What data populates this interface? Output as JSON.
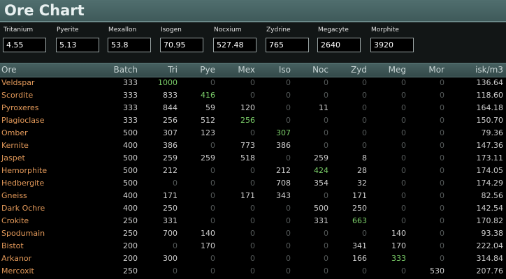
{
  "window": {
    "title": "Ore Chart"
  },
  "minerals": [
    {
      "label": "Tritanium",
      "value": "4.55"
    },
    {
      "label": "Pyerite",
      "value": "5.13"
    },
    {
      "label": "Mexallon",
      "value": "53.8"
    },
    {
      "label": "Isogen",
      "value": "70.95"
    },
    {
      "label": "Nocxium",
      "value": "527.48"
    },
    {
      "label": "Zydrine",
      "value": "765"
    },
    {
      "label": "Megacyte",
      "value": "2640"
    },
    {
      "label": "Morphite",
      "value": "3920"
    }
  ],
  "table": {
    "headers": [
      "Ore",
      "Batch",
      "Tri",
      "Pye",
      "Mex",
      "Iso",
      "Noc",
      "Zyd",
      "Meg",
      "Mor",
      "isk/m3"
    ],
    "rows": [
      {
        "ore": "Veldspar",
        "values": [
          "333",
          "1000",
          "0",
          "0",
          "0",
          "0",
          "0",
          "0",
          "0",
          "136.64"
        ],
        "highlight": 1
      },
      {
        "ore": "Scordite",
        "values": [
          "333",
          "833",
          "416",
          "0",
          "0",
          "0",
          "0",
          "0",
          "0",
          "118.60"
        ],
        "highlight": 2
      },
      {
        "ore": "Pyroxeres",
        "values": [
          "333",
          "844",
          "59",
          "120",
          "0",
          "11",
          "0",
          "0",
          "0",
          "164.18"
        ],
        "highlight": -1
      },
      {
        "ore": "Plagioclase",
        "values": [
          "333",
          "256",
          "512",
          "256",
          "0",
          "0",
          "0",
          "0",
          "0",
          "150.70"
        ],
        "highlight": 3
      },
      {
        "ore": "Omber",
        "values": [
          "500",
          "307",
          "123",
          "0",
          "307",
          "0",
          "0",
          "0",
          "0",
          "79.36"
        ],
        "highlight": 4
      },
      {
        "ore": "Kernite",
        "values": [
          "400",
          "386",
          "0",
          "773",
          "386",
          "0",
          "0",
          "0",
          "0",
          "147.36"
        ],
        "highlight": -1
      },
      {
        "ore": "Jaspet",
        "values": [
          "500",
          "259",
          "259",
          "518",
          "0",
          "259",
          "8",
          "0",
          "0",
          "173.11"
        ],
        "highlight": -1
      },
      {
        "ore": "Hemorphite",
        "values": [
          "500",
          "212",
          "0",
          "0",
          "212",
          "424",
          "28",
          "0",
          "0",
          "174.05"
        ],
        "highlight": 5
      },
      {
        "ore": "Hedbergite",
        "values": [
          "500",
          "0",
          "0",
          "0",
          "708",
          "354",
          "32",
          "0",
          "0",
          "174.29"
        ],
        "highlight": -1
      },
      {
        "ore": "Gneiss",
        "values": [
          "400",
          "171",
          "0",
          "171",
          "343",
          "0",
          "171",
          "0",
          "0",
          "82.56"
        ],
        "highlight": -1
      },
      {
        "ore": "Dark Ochre",
        "values": [
          "400",
          "250",
          "0",
          "0",
          "0",
          "500",
          "250",
          "0",
          "0",
          "142.54"
        ],
        "highlight": -1
      },
      {
        "ore": "Crokite",
        "values": [
          "250",
          "331",
          "0",
          "0",
          "0",
          "331",
          "663",
          "0",
          "0",
          "170.82"
        ],
        "highlight": 6
      },
      {
        "ore": "Spodumain",
        "values": [
          "250",
          "700",
          "140",
          "0",
          "0",
          "0",
          "0",
          "140",
          "0",
          "93.38"
        ],
        "highlight": -1
      },
      {
        "ore": "Bistot",
        "values": [
          "200",
          "0",
          "170",
          "0",
          "0",
          "0",
          "341",
          "170",
          "0",
          "222.04"
        ],
        "highlight": -1
      },
      {
        "ore": "Arkanor",
        "values": [
          "200",
          "300",
          "0",
          "0",
          "0",
          "0",
          "166",
          "333",
          "0",
          "314.84"
        ],
        "highlight": 7
      },
      {
        "ore": "Mercoxit",
        "values": [
          "250",
          "0",
          "0",
          "0",
          "0",
          "0",
          "0",
          "0",
          "530",
          "207.76"
        ],
        "highlight": -1
      }
    ]
  },
  "colors": {
    "title_bar": "#4a6666",
    "ore_name": "#e49a5a",
    "highlight": "#7cd06a",
    "zero": "#555a5a"
  }
}
